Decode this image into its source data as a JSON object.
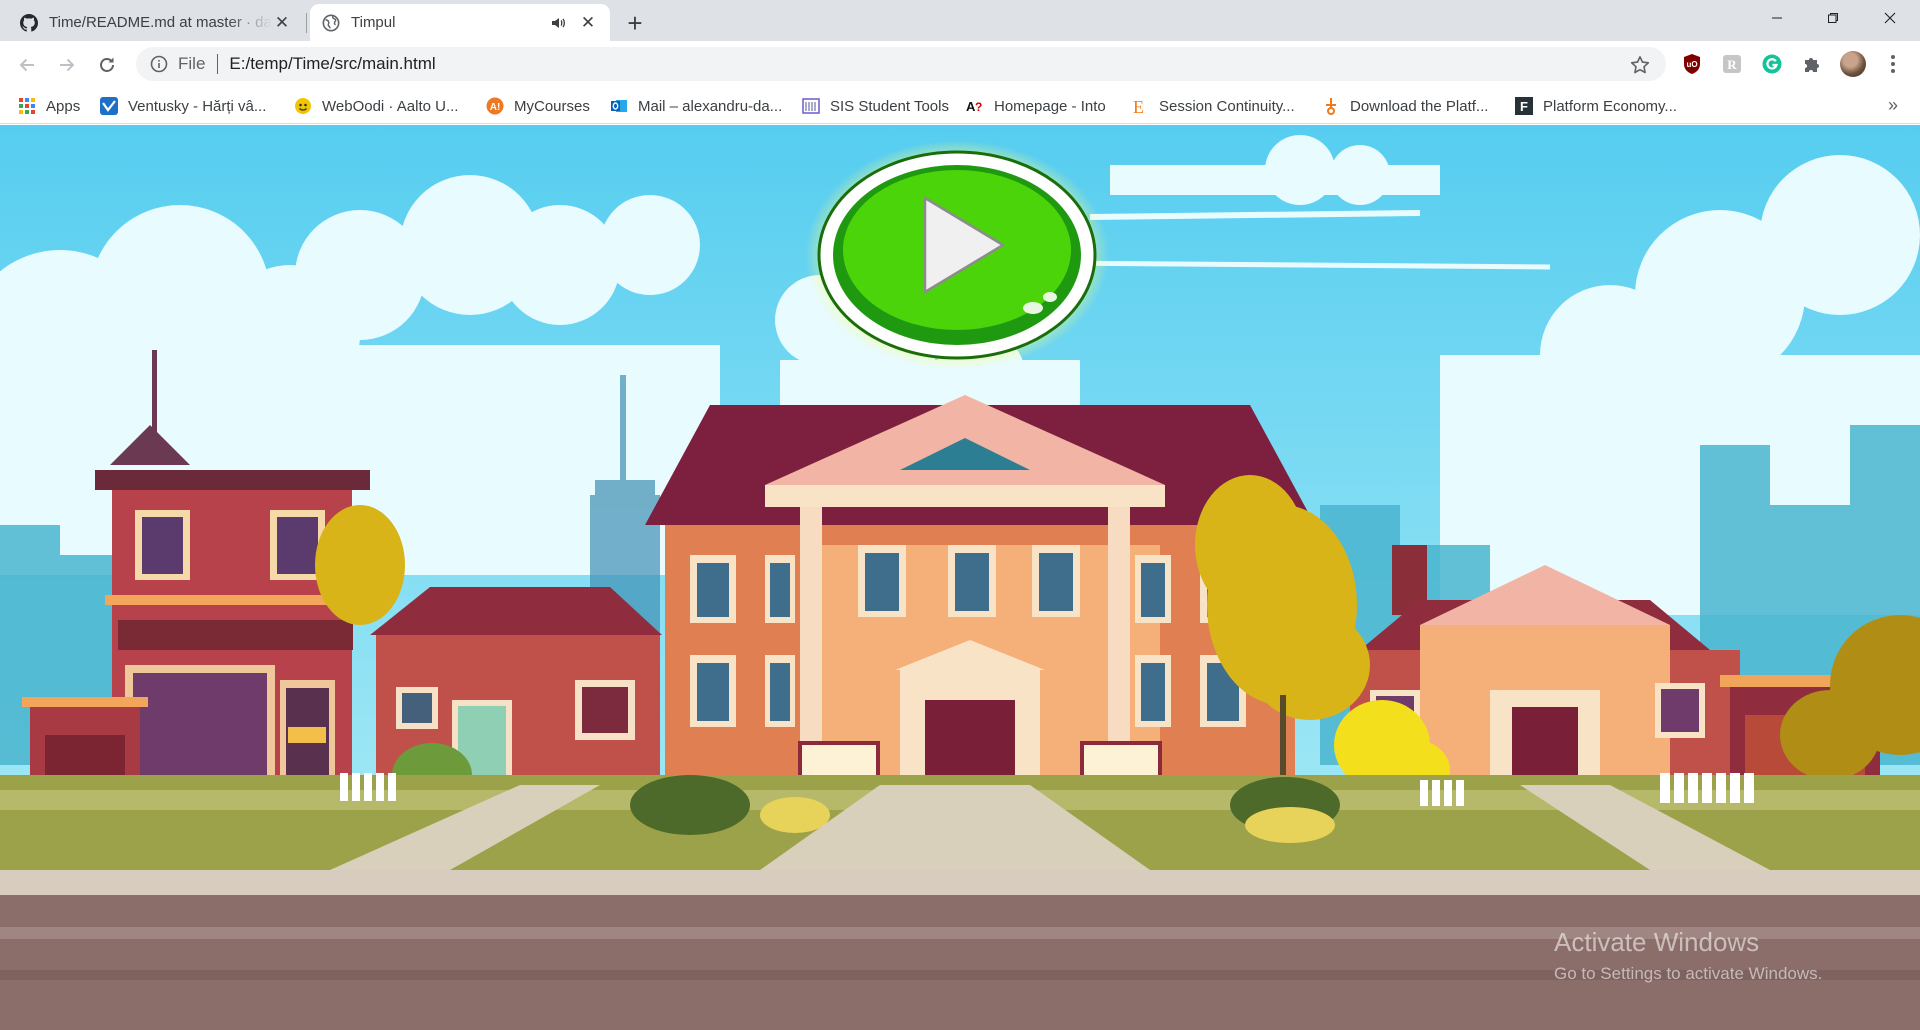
{
  "tabs": [
    {
      "title": "Time/README.md at master · dan",
      "favicon": "github-icon",
      "active": false
    },
    {
      "title": "Timpul",
      "favicon": "globe-icon",
      "active": true,
      "audio": true
    }
  ],
  "window_controls": [
    "minimize-icon",
    "maximize-icon",
    "close-icon"
  ],
  "toolbar": {
    "scheme_label": "File",
    "url": "E:/temp/Time/src/main.html",
    "extensions": [
      "ublock-icon",
      "readkit-icon",
      "grammarly-icon",
      "puzzle-icon"
    ]
  },
  "bookmarks": [
    {
      "label": "Apps",
      "icon": "apps-grid-icon"
    },
    {
      "label": "Ventusky - Hărți vâ...",
      "icon": "ventusky-icon"
    },
    {
      "label": "WebOodi · Aalto U...",
      "icon": "weboodi-icon"
    },
    {
      "label": "MyCourses",
      "icon": "mycourses-icon"
    },
    {
      "label": "Mail – alexandru-da...",
      "icon": "outlook-icon"
    },
    {
      "label": "SIS Student Tools",
      "icon": "sis-icon"
    },
    {
      "label": "Homepage - Into",
      "icon": "into-icon"
    },
    {
      "label": "Session Continuity...",
      "icon": "session-icon"
    },
    {
      "label": "Download the Platf...",
      "icon": "download-icon"
    },
    {
      "label": "Platform Economy...",
      "icon": "platform-icon"
    }
  ],
  "game": {
    "play_button": "play-icon",
    "colors": {
      "sky": "#5fd0ee",
      "button_green": "#4cd40a",
      "road": "#8b6e6a"
    }
  },
  "watermark": {
    "line1": "Activate Windows",
    "line2": "Go to Settings to activate Windows."
  }
}
